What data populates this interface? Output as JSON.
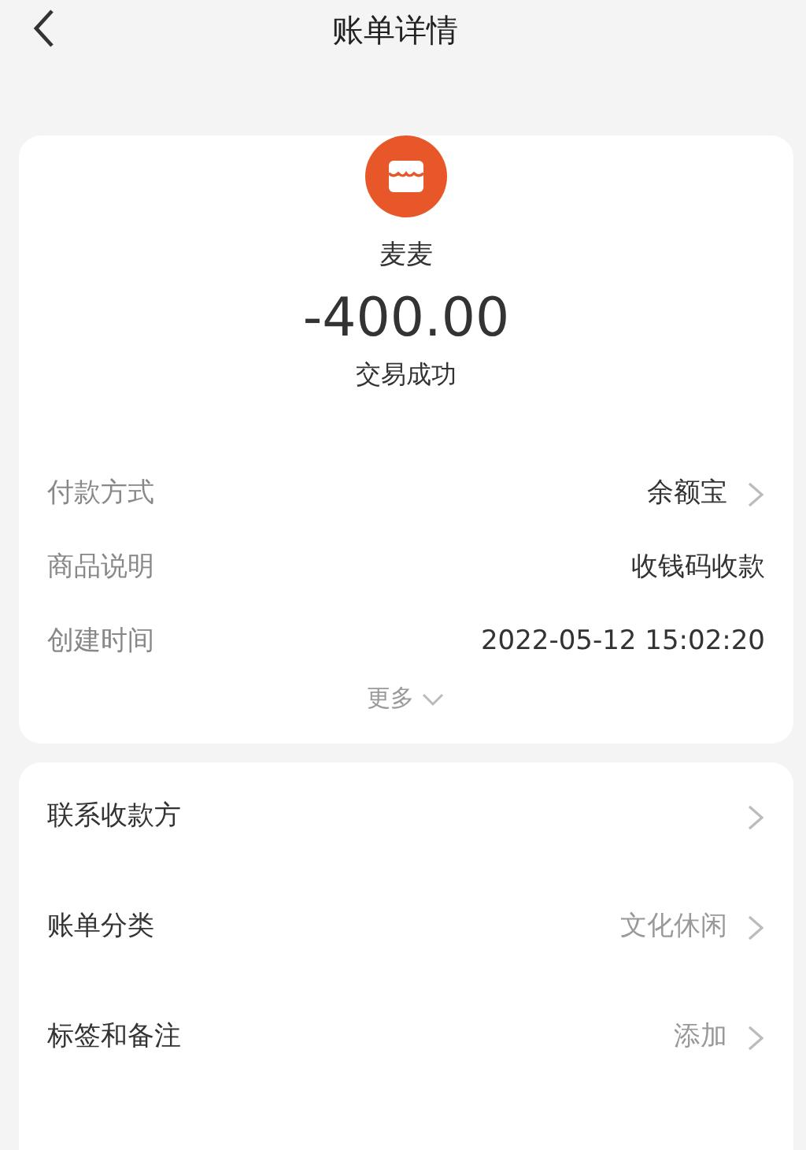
{
  "header": {
    "title": "账单详情"
  },
  "payee": {
    "name": "麦麦",
    "amount": "-400.00",
    "status": "交易成功"
  },
  "details": [
    {
      "label": "付款方式",
      "value": "余额宝",
      "chevron": true
    },
    {
      "label": "商品说明",
      "value": "收钱码收款",
      "chevron": false
    },
    {
      "label": "创建时间",
      "value": "2022-05-12 15:02:20",
      "chevron": false
    }
  ],
  "more": "更多",
  "actions": [
    {
      "label": "联系收款方"
    },
    {
      "label": "账单分类",
      "value": "文化休闲"
    },
    {
      "label": "标签和备注",
      "value": "添加"
    }
  ]
}
